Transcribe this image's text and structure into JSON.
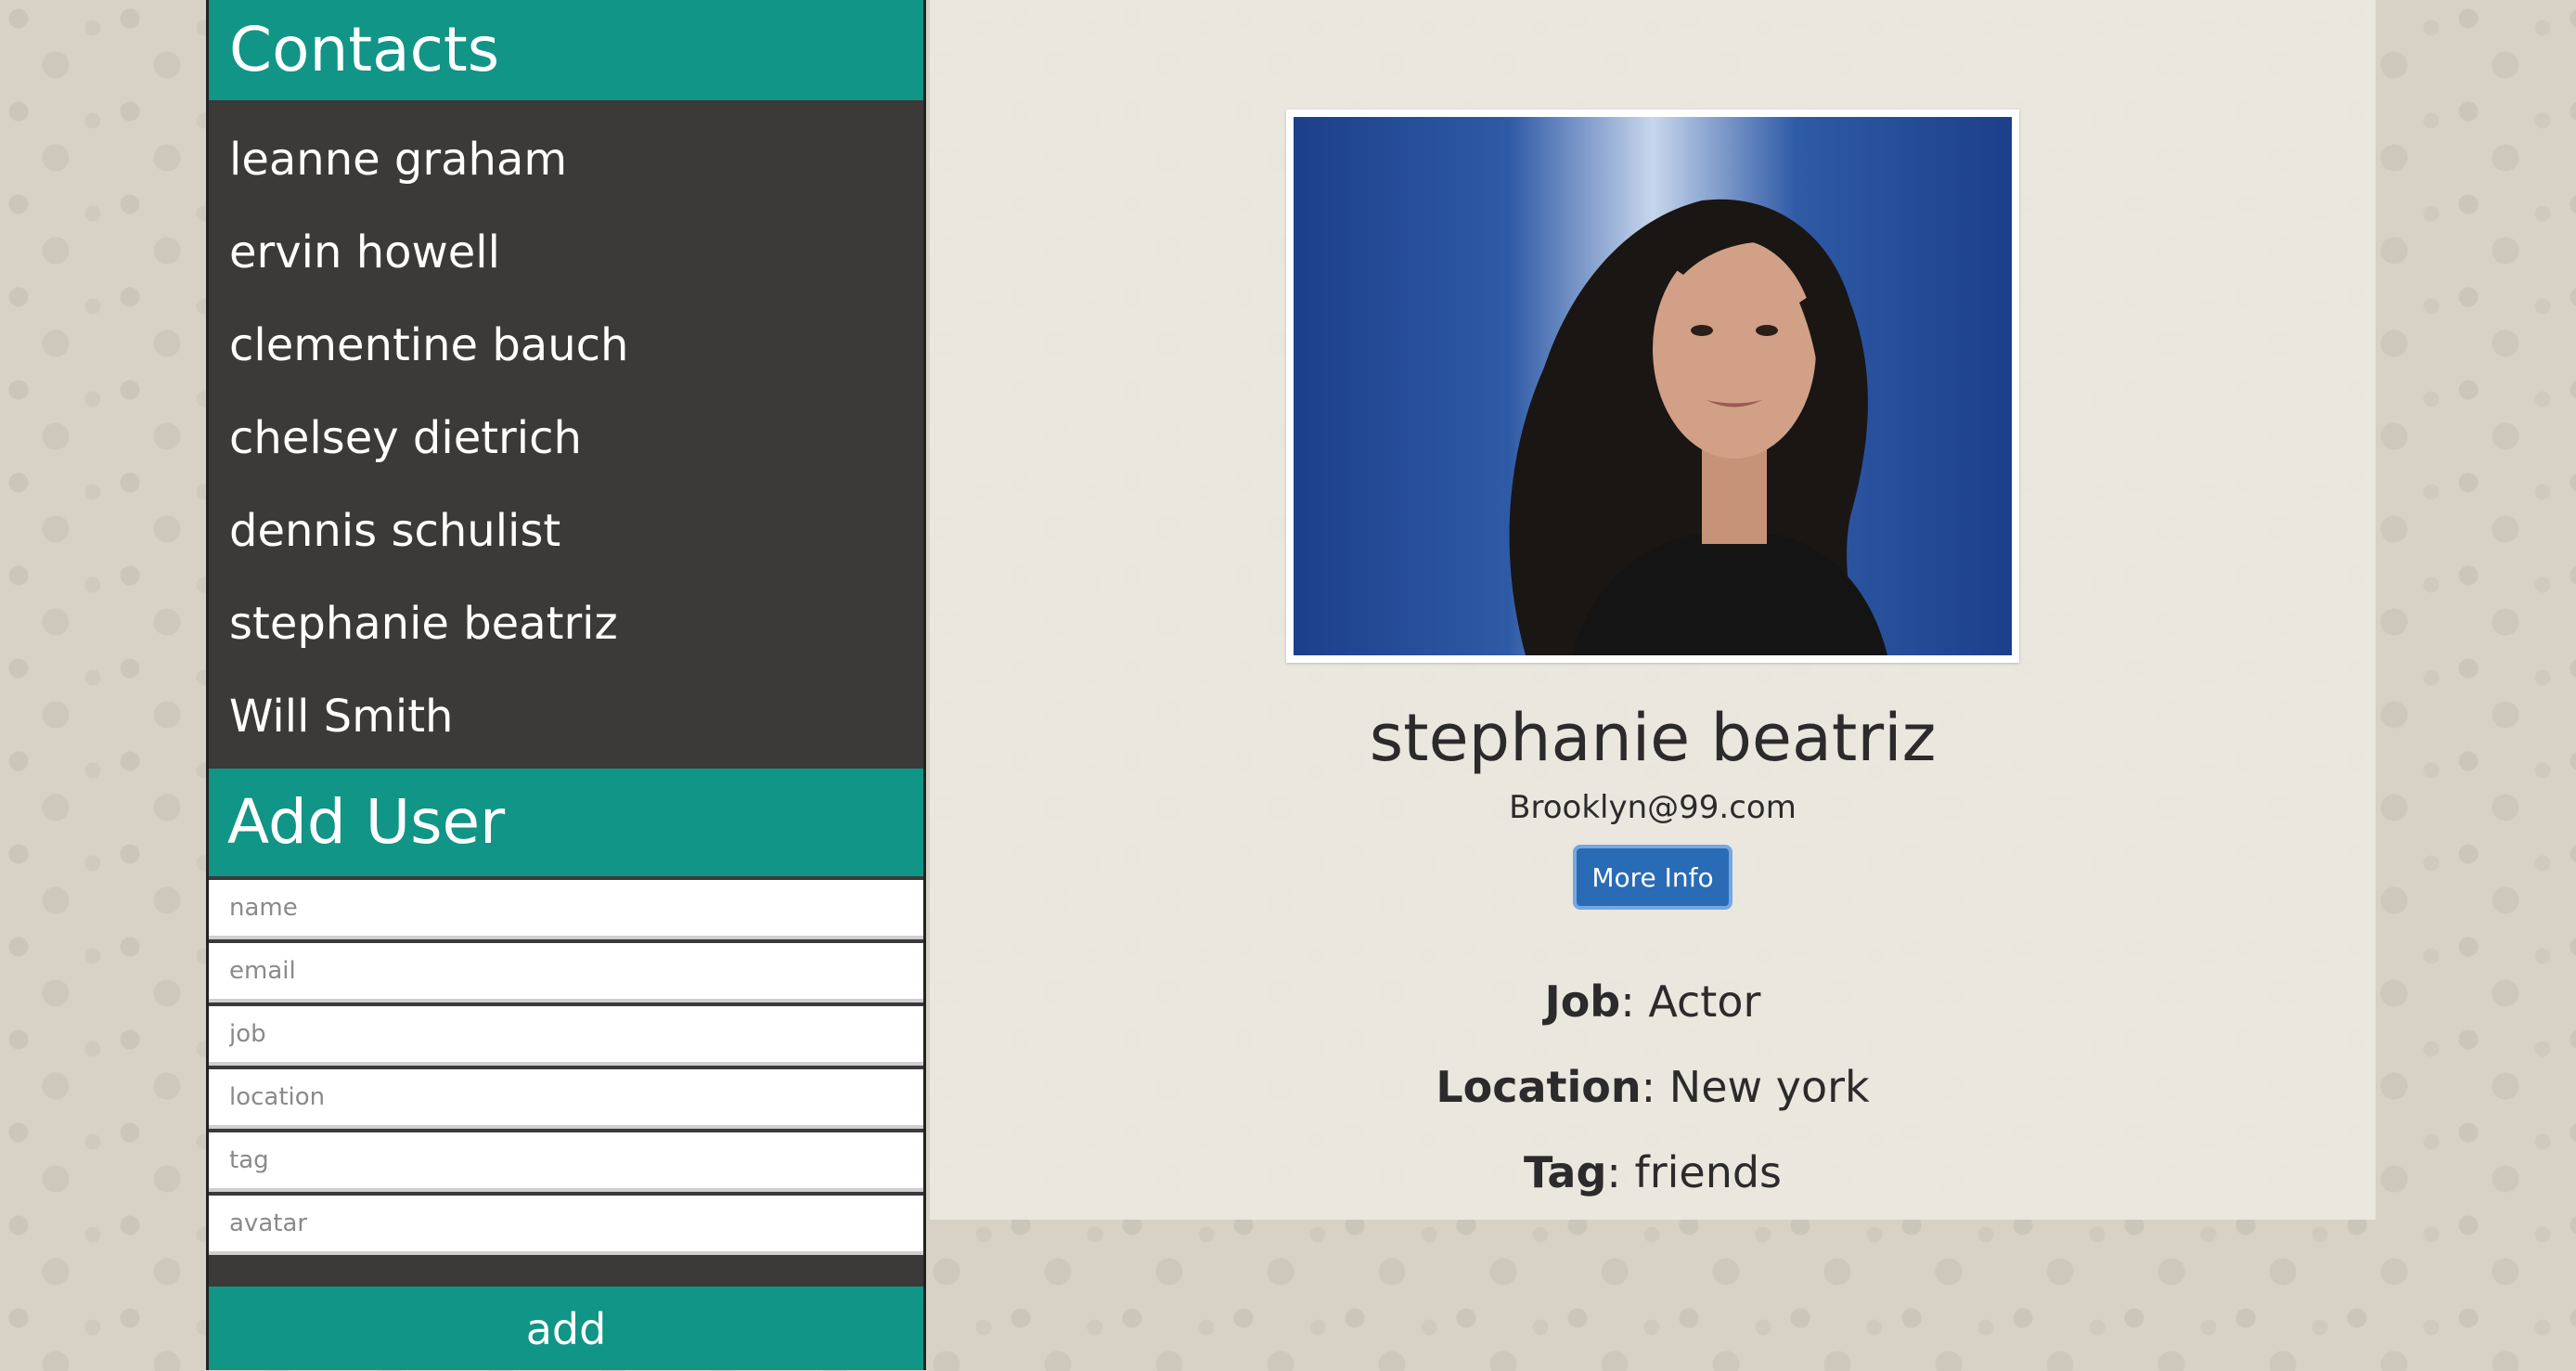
{
  "sidebar": {
    "title": "Contacts",
    "contacts": [
      "leanne graham",
      "ervin howell",
      "clementine bauch",
      "chelsey dietrich",
      "dennis schulist",
      "stephanie beatriz",
      "Will Smith"
    ]
  },
  "add_user": {
    "title": "Add User",
    "placeholders": {
      "name": "name",
      "email": "email",
      "job": "job",
      "location": "location",
      "tag": "tag",
      "avatar": "avatar"
    },
    "submit_label": "add"
  },
  "detail": {
    "name": "stephanie beatriz",
    "email": "Brooklyn@99.com",
    "more_info_label": "More Info",
    "job_label": "Job",
    "job_value": "Actor",
    "location_label": "Location",
    "location_value": "New york",
    "tag_label": "Tag",
    "tag_value": "friends"
  },
  "colors": {
    "accent": "#109587",
    "sidebar_bg": "#3b3a38",
    "button": "#2a6bb6"
  }
}
